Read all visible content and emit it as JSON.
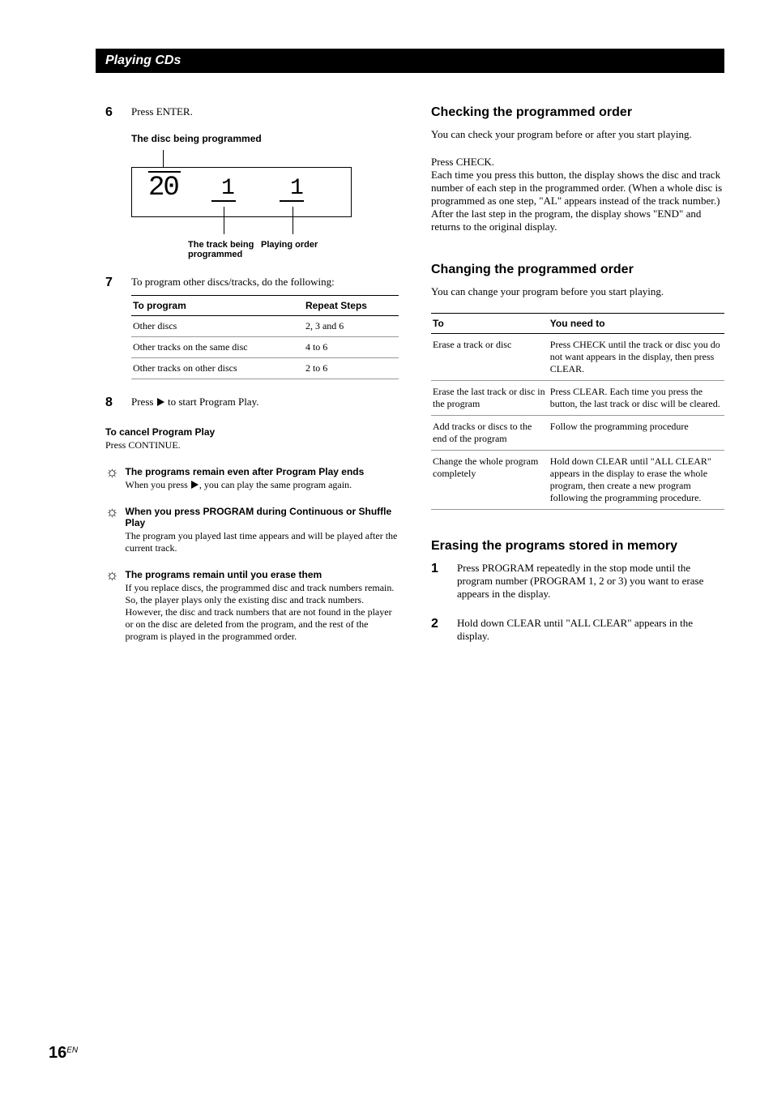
{
  "header": {
    "title": "Playing CDs"
  },
  "left": {
    "step6": {
      "num": "6",
      "text": "Press ENTER."
    },
    "diagram": {
      "topLabel": "The disc being programmed",
      "num20": "20",
      "num1a": "1",
      "num1b": "1",
      "bottomLabel1": "The track being programmed",
      "bottomLabel2": "Playing order"
    },
    "step7": {
      "num": "7",
      "text": "To program other discs/tracks, do the following:",
      "table": {
        "h1": "To program",
        "h2": "Repeat Steps",
        "rows": [
          {
            "c1": "Other discs",
            "c2": "2, 3 and 6"
          },
          {
            "c1": "Other tracks on the same disc",
            "c2": "4 to 6"
          },
          {
            "c1": "Other tracks on other discs",
            "c2": "2 to 6"
          }
        ]
      }
    },
    "step8": {
      "num": "8",
      "pre": "Press ",
      "post": " to start Program Play."
    },
    "cancel": {
      "title": "To cancel Program Play",
      "text": "Press CONTINUE."
    },
    "tip1": {
      "title": "The programs remain even after Program Play ends",
      "pre": "When you press ",
      "post": ", you can play the same program again."
    },
    "tip2": {
      "title": "When you press PROGRAM during Continuous or Shuffle Play",
      "text": "The program you played last time appears and will be played after the current track."
    },
    "tip3": {
      "title": "The programs remain until you erase them",
      "text": "If you replace discs, the programmed disc and track numbers remain. So, the player plays only the existing disc and track numbers. However, the disc and track numbers that are not found in the player or on the disc are deleted from the program, and the rest of the program is played in the programmed order."
    }
  },
  "right": {
    "check": {
      "title": "Checking the programmed order",
      "p1": "You can check your program before or after you start playing.",
      "p2": "Press CHECK.",
      "p3": "Each time you press this button, the display shows the disc and track number of each step in the programmed order. (When a whole disc is programmed as one step, \"AL\" appears instead of the track number.) After the last step in the program, the display shows \"END\" and returns to the original display."
    },
    "change": {
      "title": "Changing the programmed order",
      "p1": "You can change your program before you start playing.",
      "table": {
        "h1": "To",
        "h2": "You need to",
        "rows": [
          {
            "c1": "Erase a track or disc",
            "c2": "Press CHECK until the track or disc you do not want appears in the display, then press CLEAR."
          },
          {
            "c1": "Erase the last track or disc in the program",
            "c2": "Press CLEAR. Each time you press the button, the last track or disc will be cleared."
          },
          {
            "c1": "Add tracks or discs to the end of the program",
            "c2": "Follow the programming procedure"
          },
          {
            "c1": "Change the whole program completely",
            "c2": "Hold down CLEAR until \"ALL CLEAR\" appears in the display to erase the whole program, then create a new program following the programming procedure."
          }
        ]
      }
    },
    "erase": {
      "title": "Erasing the programs stored in memory",
      "s1num": "1",
      "s1": "Press PROGRAM repeatedly in the stop mode until the program number (PROGRAM 1, 2  or 3) you want to erase appears in the display.",
      "s2num": "2",
      "s2": "Hold down CLEAR until \"ALL CLEAR\" appears in the display."
    }
  },
  "pagenum": {
    "big": "16",
    "small": "EN"
  }
}
